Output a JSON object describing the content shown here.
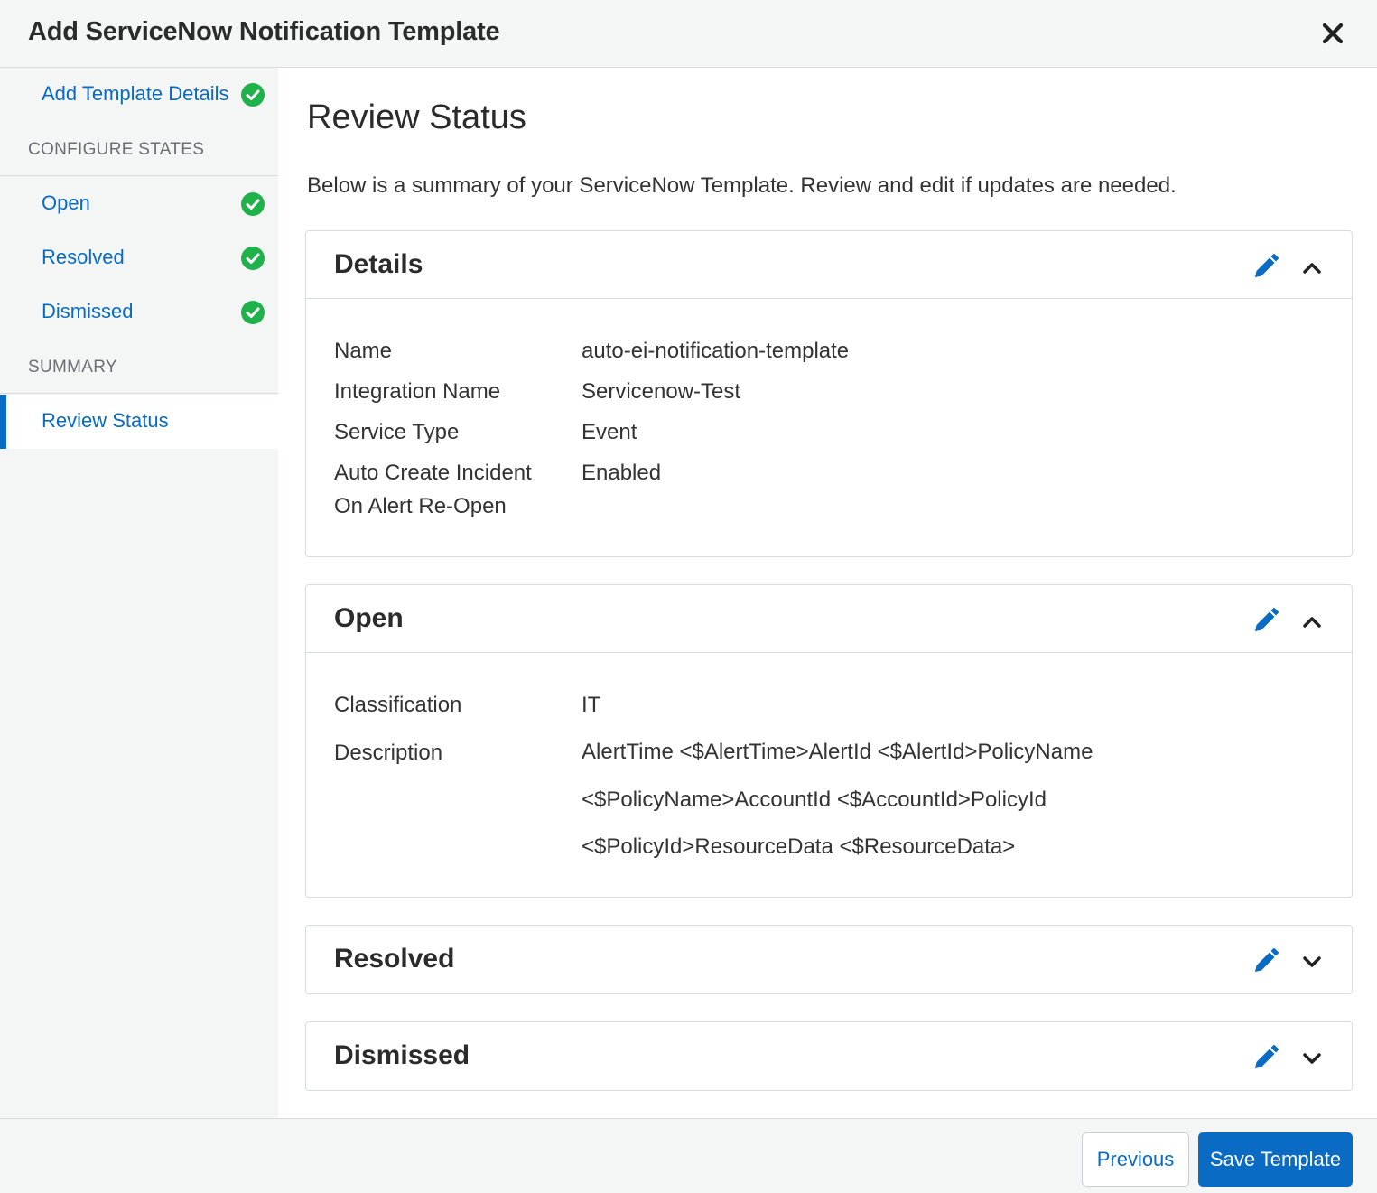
{
  "header": {
    "title": "Add ServiceNow Notification Template"
  },
  "sidebar": {
    "steps": [
      {
        "label": "Add Template Details",
        "completed": true
      },
      {
        "label": "Open",
        "completed": true
      },
      {
        "label": "Resolved",
        "completed": true
      },
      {
        "label": "Dismissed",
        "completed": true
      },
      {
        "label": "Review Status",
        "completed": false,
        "active": true
      }
    ],
    "sections": {
      "configure": "CONFIGURE STATES",
      "summary": "SUMMARY"
    }
  },
  "main": {
    "title": "Review Status",
    "subtitle": "Below is a summary of your ServiceNow Template. Review and edit if updates are needed.",
    "details": {
      "title": "Details",
      "rows": [
        {
          "key": "Name",
          "value": "auto-ei-notification-template"
        },
        {
          "key": "Integration Name",
          "value": "Servicenow-Test"
        },
        {
          "key": "Service Type",
          "value": "Event"
        },
        {
          "key_line1": "Auto Create Incident",
          "key_line2": "On Alert Re-Open",
          "value": "Enabled"
        }
      ]
    },
    "open": {
      "title": "Open",
      "classification_label": "Classification",
      "classification_value": "IT",
      "description_label": "Description",
      "description_lines": [
        "AlertTime <$AlertTime>AlertId <$AlertId>PolicyName",
        "<$PolicyName>AccountId <$AccountId>PolicyId",
        "<$PolicyId>ResourceData <$ResourceData>"
      ]
    },
    "resolved": {
      "title": "Resolved"
    },
    "dismissed": {
      "title": "Dismissed"
    }
  },
  "footer": {
    "previous_label": "Previous",
    "save_label": "Save Template"
  },
  "colors": {
    "accent": "#0a6bc4",
    "success": "#1fb24a",
    "sidebar_bg": "#f4f5f5",
    "border": "#d9dcdf"
  },
  "icons": {
    "close": "close-icon",
    "check": "check-circle-icon",
    "edit": "pencil-icon",
    "collapse": "chevron-up-icon",
    "expand": "chevron-down-icon"
  }
}
